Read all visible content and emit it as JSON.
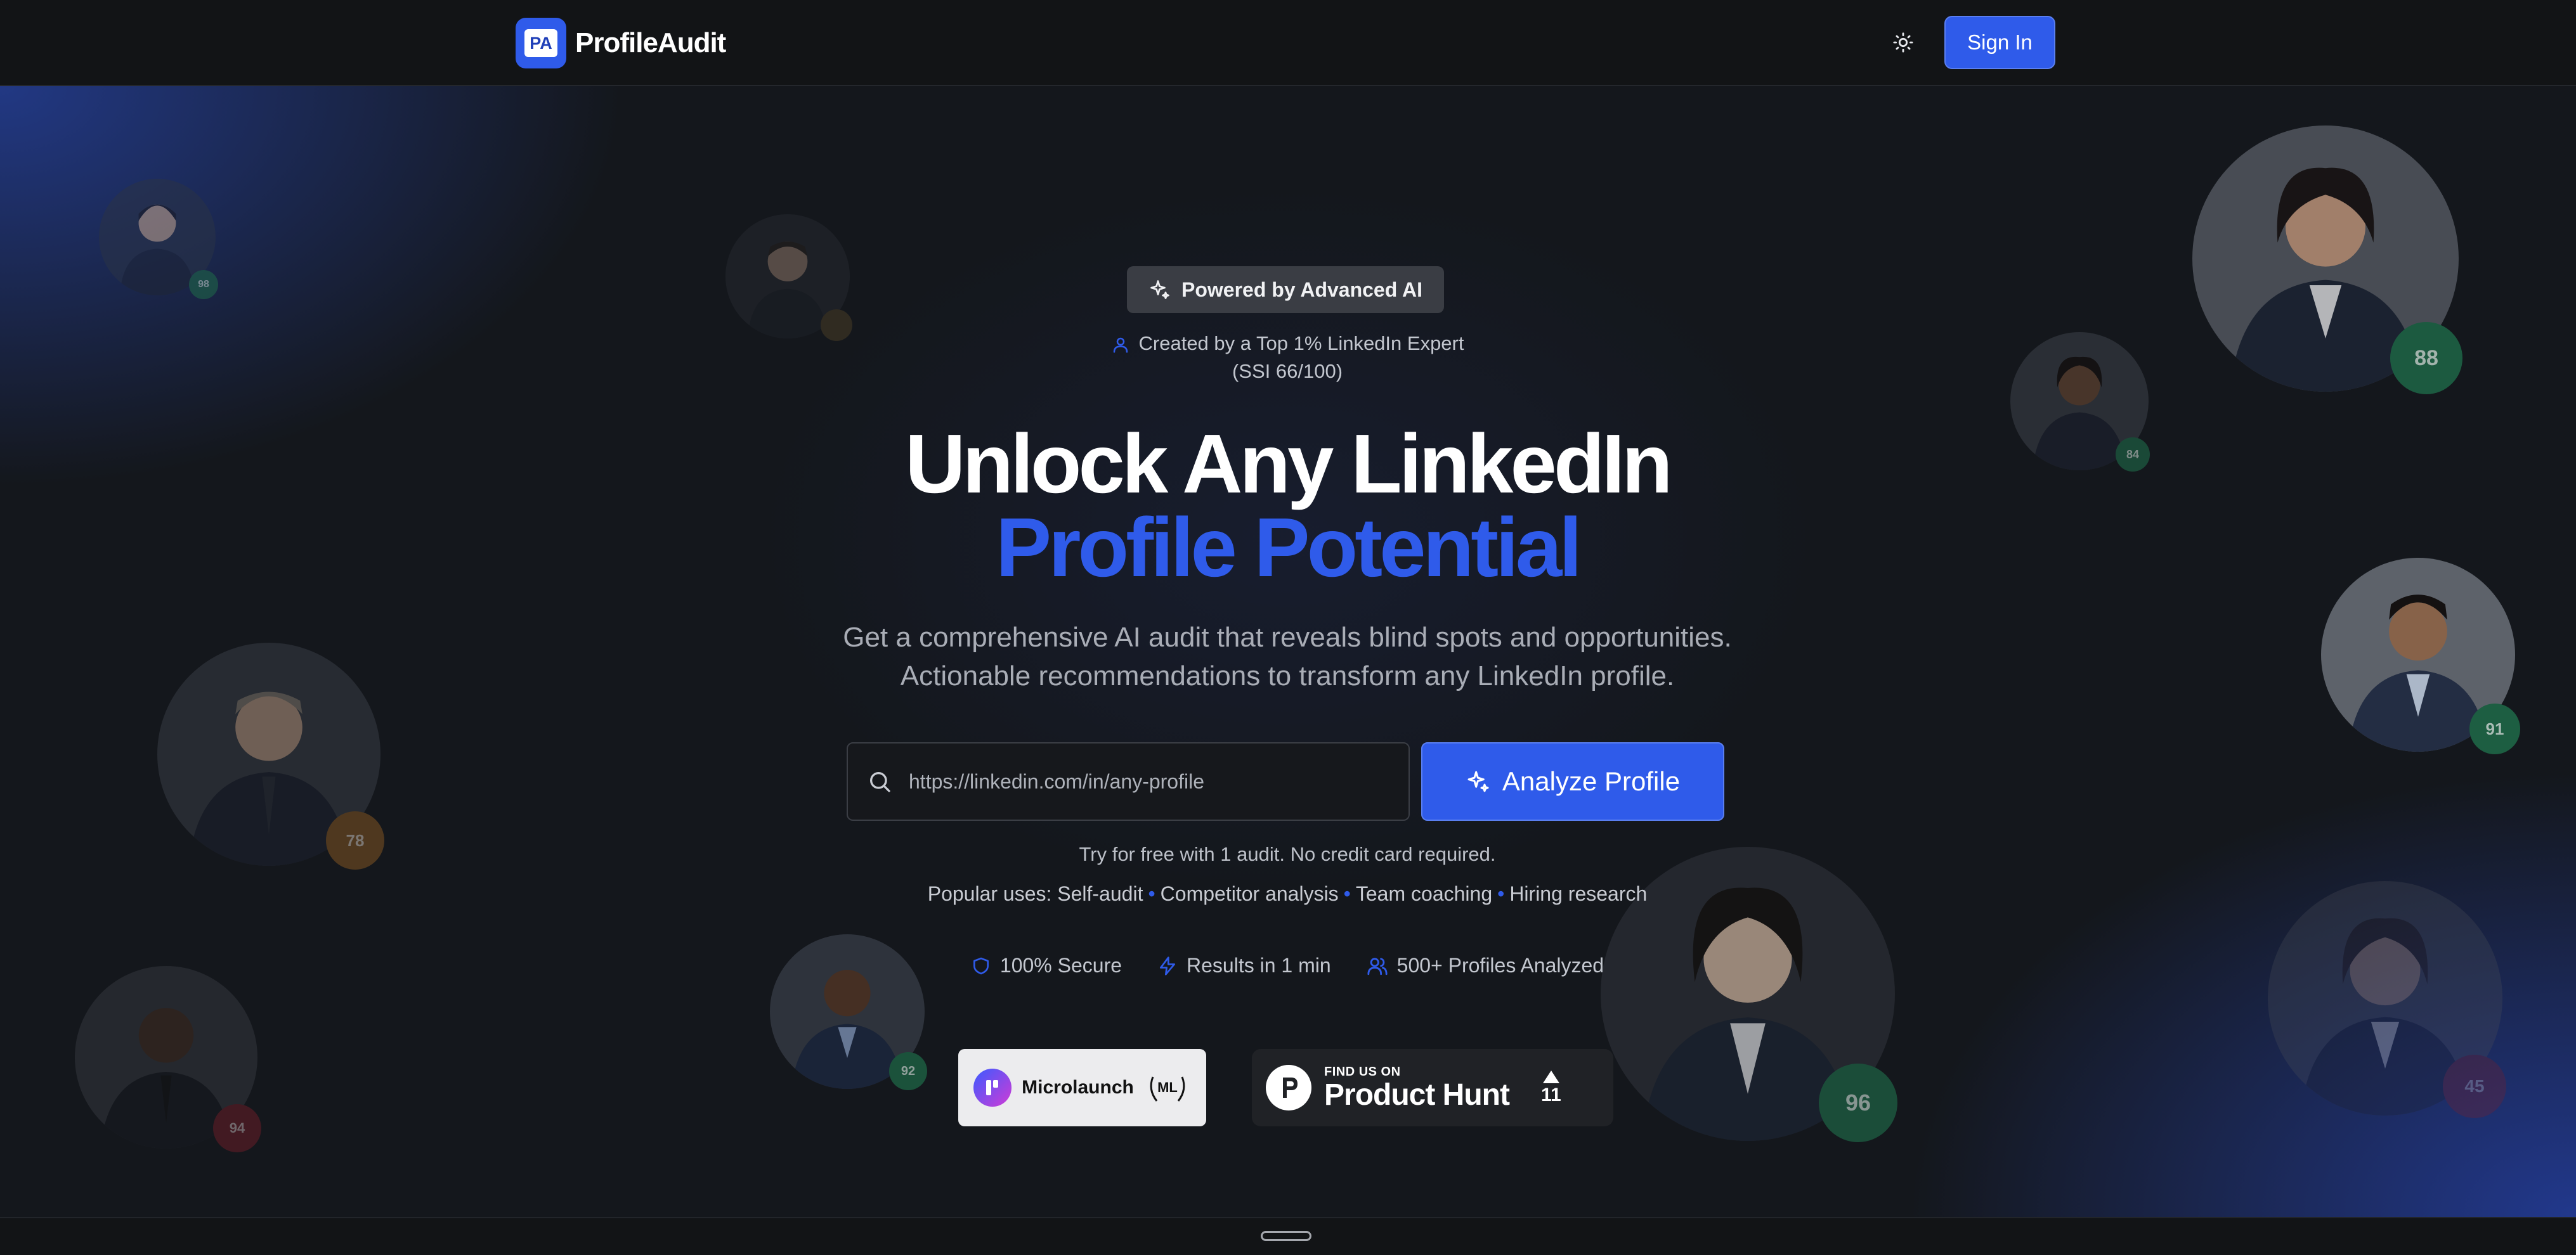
{
  "navbar": {
    "logo_badge": "PA",
    "logo_text": "ProfileAudit",
    "theme_icon": "sun-icon",
    "signin_label": "Sign In"
  },
  "hero": {
    "badge_label": "Powered by Advanced AI",
    "creator_line1": "Created by a Top 1% LinkedIn Expert",
    "creator_line2": "(SSI 66/100)",
    "headline_line1": "Unlock Any LinkedIn",
    "headline_line2": "Profile Potential",
    "subtitle_line1": "Get a comprehensive AI audit that reveals blind spots and opportunities.",
    "subtitle_line2": "Actionable recommendations to transform any LinkedIn profile.",
    "url_placeholder": "https://linkedin.com/in/any-profile",
    "analyze_label": "Analyze Profile",
    "free_note": "Try for free with 1 audit. No credit card required.",
    "popular_prefix": "Popular uses:",
    "popular_uses": [
      "Self-audit",
      "Competitor analysis",
      "Team coaching",
      "Hiring research"
    ],
    "features": [
      {
        "icon": "shield-icon",
        "label": "100% Secure"
      },
      {
        "icon": "lightning-icon",
        "label": "Results in 1 min"
      },
      {
        "icon": "users-icon",
        "label": "500+ Profiles Analyzed"
      }
    ],
    "microlaunch_label": "Microlaunch",
    "producthunt_small": "FIND US ON",
    "producthunt_big": "Product Hunt",
    "producthunt_votes": "11"
  },
  "avatar_scores": [
    "98",
    "88",
    "84",
    "78",
    "91",
    "94",
    "92",
    "96",
    "45"
  ],
  "colors": {
    "accent": "#2f5bea",
    "background": "#111315",
    "score_green": "#1f6b49",
    "score_orange": "#8a5a22",
    "score_red": "#7a1f2a"
  }
}
